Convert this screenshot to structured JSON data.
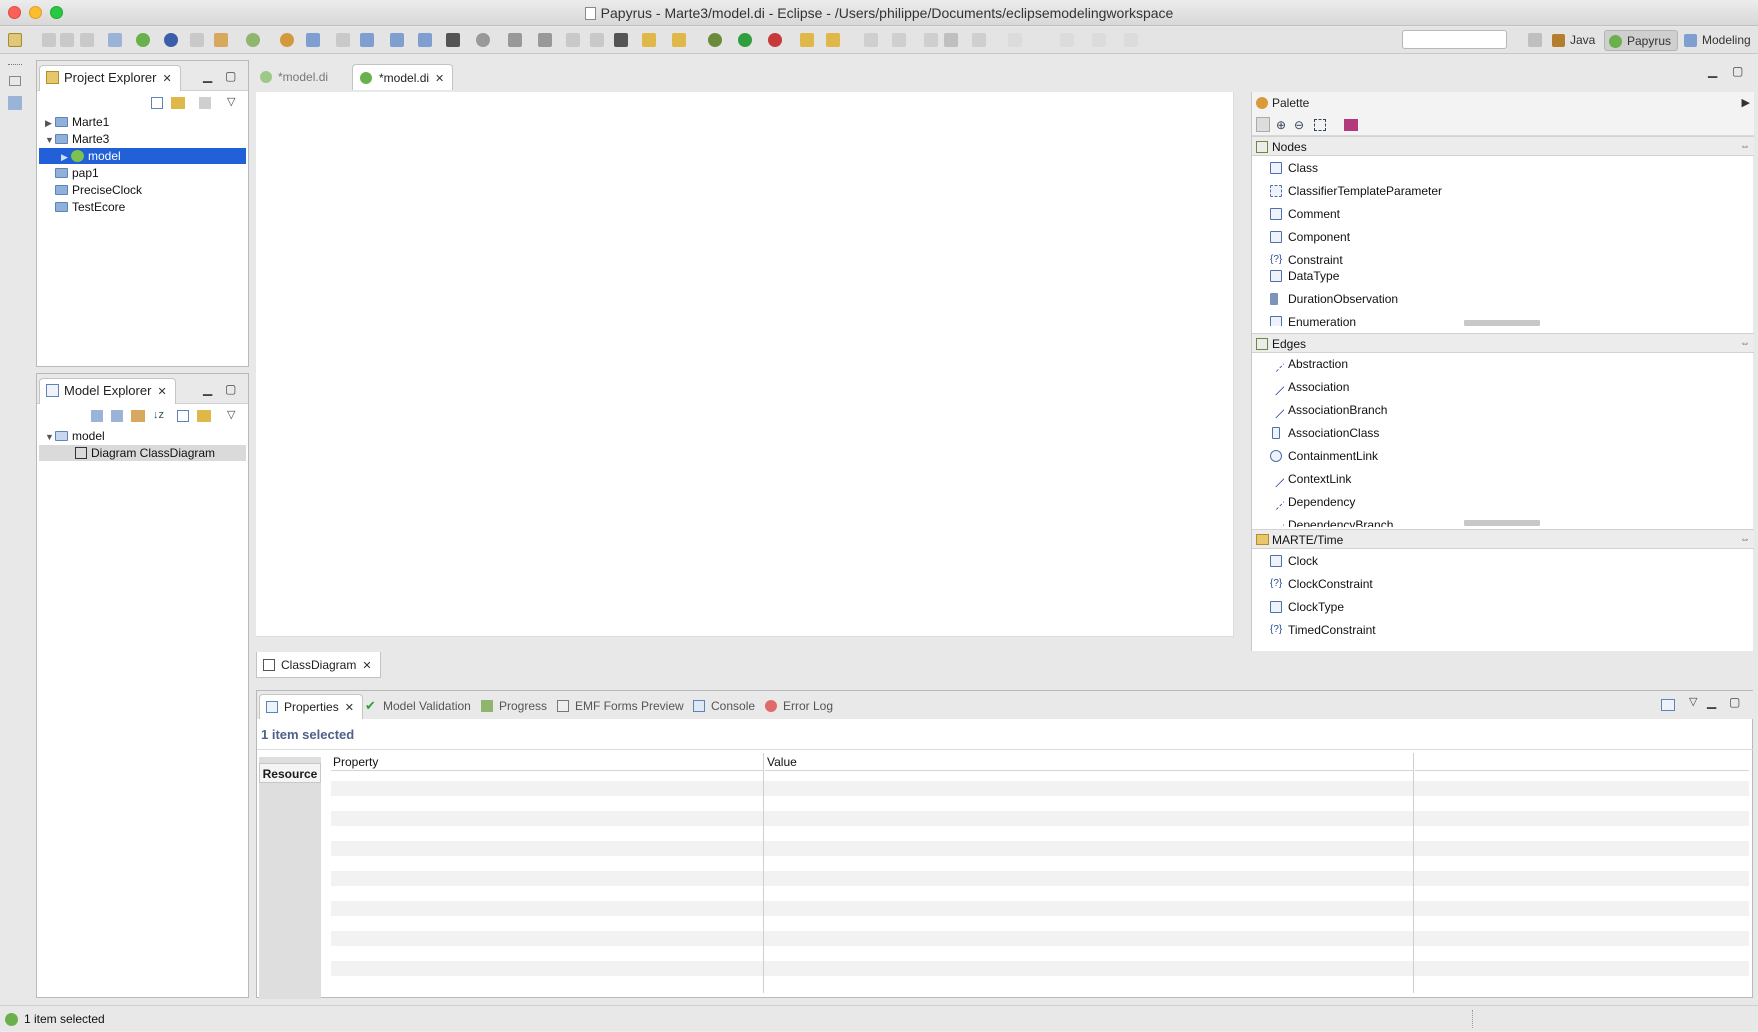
{
  "window": {
    "title": "Papyrus - Marte3/model.di - Eclipse - /Users/philippe/Documents/eclipsemodelingworkspace"
  },
  "perspectives": [
    {
      "label": "Java",
      "icon": "java-perspective-icon"
    },
    {
      "label": "Papyrus",
      "icon": "papyrus-perspective-icon",
      "active": true
    },
    {
      "label": "Modeling",
      "icon": "modeling-perspective-icon"
    }
  ],
  "project_explorer": {
    "title": "Project Explorer",
    "items": [
      {
        "label": "Marte1",
        "expanded": false
      },
      {
        "label": "Marte3",
        "expanded": true
      },
      {
        "label": "model",
        "selected": true
      },
      {
        "label": "pap1"
      },
      {
        "label": "PreciseClock"
      },
      {
        "label": "TestEcore"
      }
    ]
  },
  "model_explorer": {
    "title": "Model Explorer",
    "items": [
      {
        "label": "model"
      },
      {
        "label": "Diagram ClassDiagram"
      }
    ]
  },
  "editor": {
    "tabs": [
      {
        "label": "*model.di",
        "active": false
      },
      {
        "label": "*model.di",
        "active": true
      }
    ],
    "diagram_tab": "ClassDiagram"
  },
  "palette": {
    "title": "Palette",
    "drawers": [
      {
        "label": "Nodes",
        "items": [
          "Class",
          "ClassifierTemplateParameter",
          "Comment",
          "Component",
          "Constraint",
          "DataType",
          "DurationObservation",
          "Enumeration"
        ]
      },
      {
        "label": "Edges",
        "items": [
          "Abstraction",
          "Association",
          "AssociationBranch",
          "AssociationClass",
          "ContainmentLink",
          "ContextLink",
          "Dependency",
          "DependencyBranch"
        ]
      },
      {
        "label": "MARTE/Time",
        "items": [
          "Clock",
          "ClockConstraint",
          "ClockType",
          "TimedConstraint"
        ]
      }
    ]
  },
  "bottom_panel": {
    "tabs": [
      {
        "label": "Properties",
        "active": true
      },
      {
        "label": "Model Validation"
      },
      {
        "label": "Progress"
      },
      {
        "label": "EMF Forms Preview"
      },
      {
        "label": "Console"
      },
      {
        "label": "Error Log"
      }
    ],
    "selection_info": "1 item selected",
    "section_tab": "Resource",
    "columns": [
      "Property",
      "Value"
    ]
  },
  "status": {
    "text": "1 item selected"
  },
  "colors": {
    "selection": "#2160d6",
    "selection_info": "#50618a"
  }
}
